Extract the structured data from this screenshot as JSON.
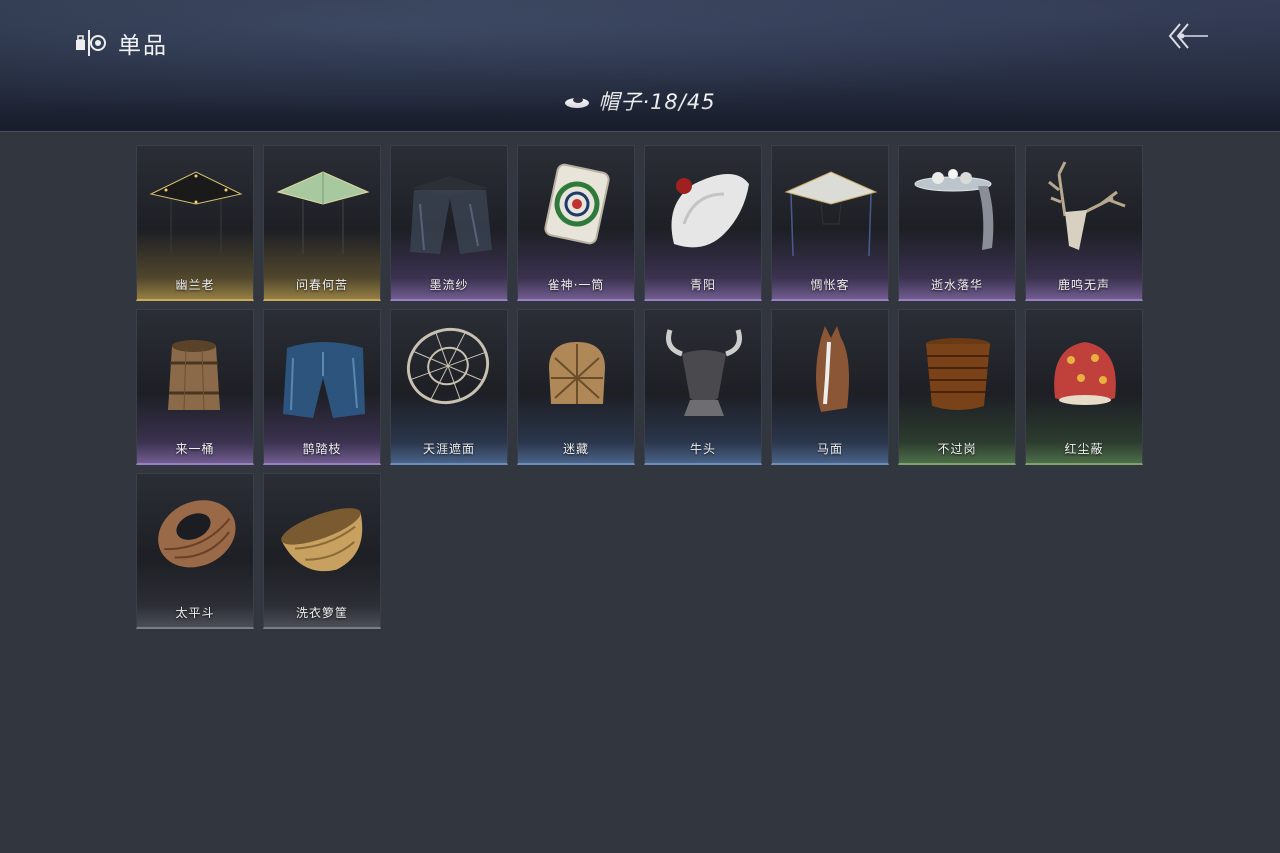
{
  "header": {
    "title": "单品",
    "title_icon": "wardrobe-icon",
    "back_icon": "back-arrow-icon",
    "category_icon": "hat-icon",
    "category_label": "帽子·18/45"
  },
  "items": [
    {
      "name": "幽兰老",
      "icon": "bamboo-hat-black-icon",
      "rarity": "gold"
    },
    {
      "name": "问春何苦",
      "icon": "bamboo-hat-green-icon",
      "rarity": "gold"
    },
    {
      "name": "墨流纱",
      "icon": "veil-hat-icon",
      "rarity": "purple"
    },
    {
      "name": "雀神·一筒",
      "icon": "mahjong-tile-icon",
      "rarity": "purple"
    },
    {
      "name": "青阳",
      "icon": "white-hat-icon",
      "rarity": "purple"
    },
    {
      "name": "惆怅客",
      "icon": "bamboo-hat-white-icon",
      "rarity": "purple"
    },
    {
      "name": "逝水落华",
      "icon": "flower-hat-icon",
      "rarity": "purple"
    },
    {
      "name": "鹿鸣无声",
      "icon": "deer-skull-icon",
      "rarity": "purple"
    },
    {
      "name": "来一桶",
      "icon": "barrel-icon",
      "rarity": "purple"
    },
    {
      "name": "鹊踏枝",
      "icon": "blue-veil-icon",
      "rarity": "purple"
    },
    {
      "name": "天涯遮面",
      "icon": "lattice-veil-icon",
      "rarity": "blue"
    },
    {
      "name": "迷藏",
      "icon": "woven-basket-icon",
      "rarity": "blue"
    },
    {
      "name": "牛头",
      "icon": "ox-head-icon",
      "rarity": "blue"
    },
    {
      "name": "马面",
      "icon": "horse-head-icon",
      "rarity": "blue"
    },
    {
      "name": "不过岗",
      "icon": "stacked-bowls-icon",
      "rarity": "green"
    },
    {
      "name": "红尘蔽",
      "icon": "red-cloth-hat-icon",
      "rarity": "green"
    },
    {
      "name": "太平斗",
      "icon": "wicker-basket-icon",
      "rarity": "grey"
    },
    {
      "name": "洗衣箩筐",
      "icon": "laundry-basket-icon",
      "rarity": "grey"
    }
  ]
}
